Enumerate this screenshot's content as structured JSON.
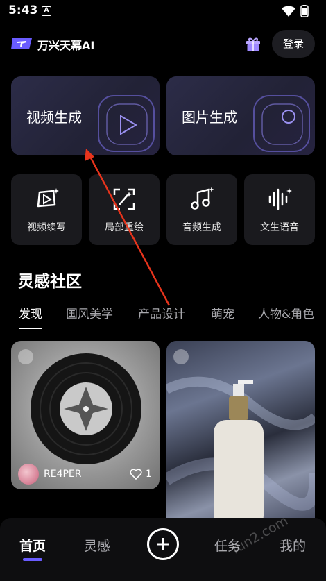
{
  "status": {
    "time": "5:43",
    "notif": "A"
  },
  "header": {
    "title": "万兴天幕AI",
    "login_label": "登录"
  },
  "big_cards": [
    {
      "label": "视频生成"
    },
    {
      "label": "图片生成"
    }
  ],
  "tools": [
    {
      "label": "视频续写",
      "icon": "video-extend-icon"
    },
    {
      "label": "局部重绘",
      "icon": "partial-redraw-icon"
    },
    {
      "label": "音频生成",
      "icon": "music-note-icon"
    },
    {
      "label": "文生语音",
      "icon": "sound-wave-icon"
    }
  ],
  "community": {
    "title": "灵感社区",
    "tabs": [
      "发现",
      "国风美学",
      "产品设计",
      "萌宠",
      "人物&角色"
    ]
  },
  "posts": [
    {
      "author": "RE4PER",
      "likes": "1"
    }
  ],
  "nav": {
    "home": "首页",
    "inspiration": "灵感",
    "tasks": "任务",
    "mine": "我的"
  },
  "watermark": "fun2.com",
  "colors": {
    "accent": "#6a5cff",
    "card_bg": "#1a1a1e",
    "big_card_bg": "#262640"
  }
}
